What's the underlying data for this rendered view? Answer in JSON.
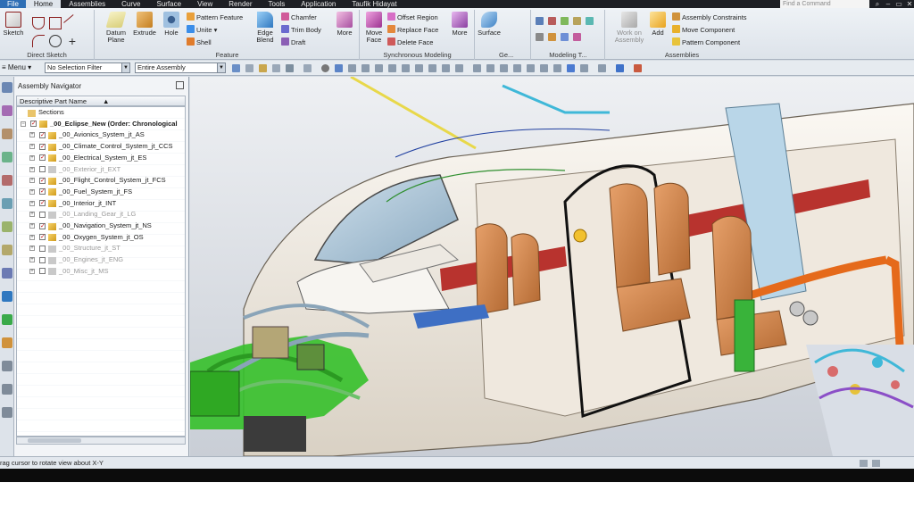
{
  "menubar": {
    "items": [
      "File",
      "Home",
      "Assemblies",
      "Curve",
      "Surface",
      "View",
      "Render",
      "Tools",
      "Application",
      "Taufik Hidayat"
    ],
    "active": "Home",
    "find_placeholder": "Find a Command"
  },
  "ribbon": {
    "groups": {
      "direct_sketch": {
        "label": "Direct Sketch",
        "sketch": "Sketch"
      },
      "feature": {
        "label": "Feature",
        "datum_plane": "Datum Plane",
        "extrude": "Extrude",
        "hole": "Hole",
        "pattern_feature": "Pattern Feature",
        "unite": "Unite",
        "shell": "Shell",
        "edge_blend": "Edge Blend",
        "chamfer": "Chamfer",
        "trim_body": "Trim Body",
        "draft": "Draft",
        "more": "More"
      },
      "synchronous_modeling": {
        "label": "Synchronous Modeling",
        "move_face": "Move Face",
        "offset_region": "Offset Region",
        "replace_face": "Replace Face",
        "delete_face": "Delete Face",
        "more": "More"
      },
      "surface": {
        "label": "Ge...",
        "surface": "Surface"
      },
      "modeling_tools": {
        "label": "Modeling T..."
      },
      "assemblies": {
        "label": "Assemblies",
        "work_on_assembly": "Work on Assembly",
        "add": "Add",
        "assembly_constraints": "Assembly Constraints",
        "move_component": "Move Component",
        "pattern_component": "Pattern Component"
      }
    }
  },
  "toolbar": {
    "menu": "Menu",
    "selection_filter": "No Selection Filter",
    "scope": "Entire Assembly"
  },
  "navigator": {
    "title": "Assembly Navigator",
    "column_header": "Descriptive Part Name",
    "rows": [
      {
        "label": "Sections",
        "level": 0,
        "type": "folder",
        "checked": null
      },
      {
        "label": "_00_Eclipse_New (Order: Chronological",
        "level": 0,
        "type": "assembly",
        "checked": true,
        "bold": true
      },
      {
        "label": "_00_Avionics_System_jt_AS",
        "level": 1,
        "type": "assembly",
        "checked": true
      },
      {
        "label": "_00_Climate_Control_System_jt_CCS",
        "level": 1,
        "type": "assembly",
        "checked": true
      },
      {
        "label": "_00_Electrical_System_jt_ES",
        "level": 1,
        "type": "assembly",
        "checked": true
      },
      {
        "label": "_00_Exterior_jt_EXT",
        "level": 1,
        "type": "assembly",
        "checked": false
      },
      {
        "label": "_00_Flight_Control_System_jt_FCS",
        "level": 1,
        "type": "assembly",
        "checked": true
      },
      {
        "label": "_00_Fuel_System_jt_FS",
        "level": 1,
        "type": "assembly",
        "checked": true
      },
      {
        "label": "_00_Interior_jt_INT",
        "level": 1,
        "type": "assembly",
        "checked": true
      },
      {
        "label": "_00_Landing_Gear_jt_LG",
        "level": 1,
        "type": "assembly",
        "checked": false
      },
      {
        "label": "_00_Navigation_System_jt_NS",
        "level": 1,
        "type": "assembly",
        "checked": true
      },
      {
        "label": "_00_Oxygen_System_jt_OS",
        "level": 1,
        "type": "assembly",
        "checked": true
      },
      {
        "label": "_00_Structure_jt_ST",
        "level": 1,
        "type": "assembly",
        "checked": false
      },
      {
        "label": "_00_Engines_jt_ENG",
        "level": 1,
        "type": "assembly",
        "checked": false
      },
      {
        "label": "_00_Misc_jt_MS",
        "level": 1,
        "type": "assembly",
        "checked": false
      }
    ]
  },
  "status": {
    "message": "rag cursor to rotate view about X-Y"
  },
  "colors": {
    "menubar": "#1d1f24",
    "accent": "#2f6fb5",
    "checked": "#c0161a",
    "seat": "#d48c55",
    "wiring_green": "#35c02a",
    "fuselage": "#f2ede6"
  }
}
